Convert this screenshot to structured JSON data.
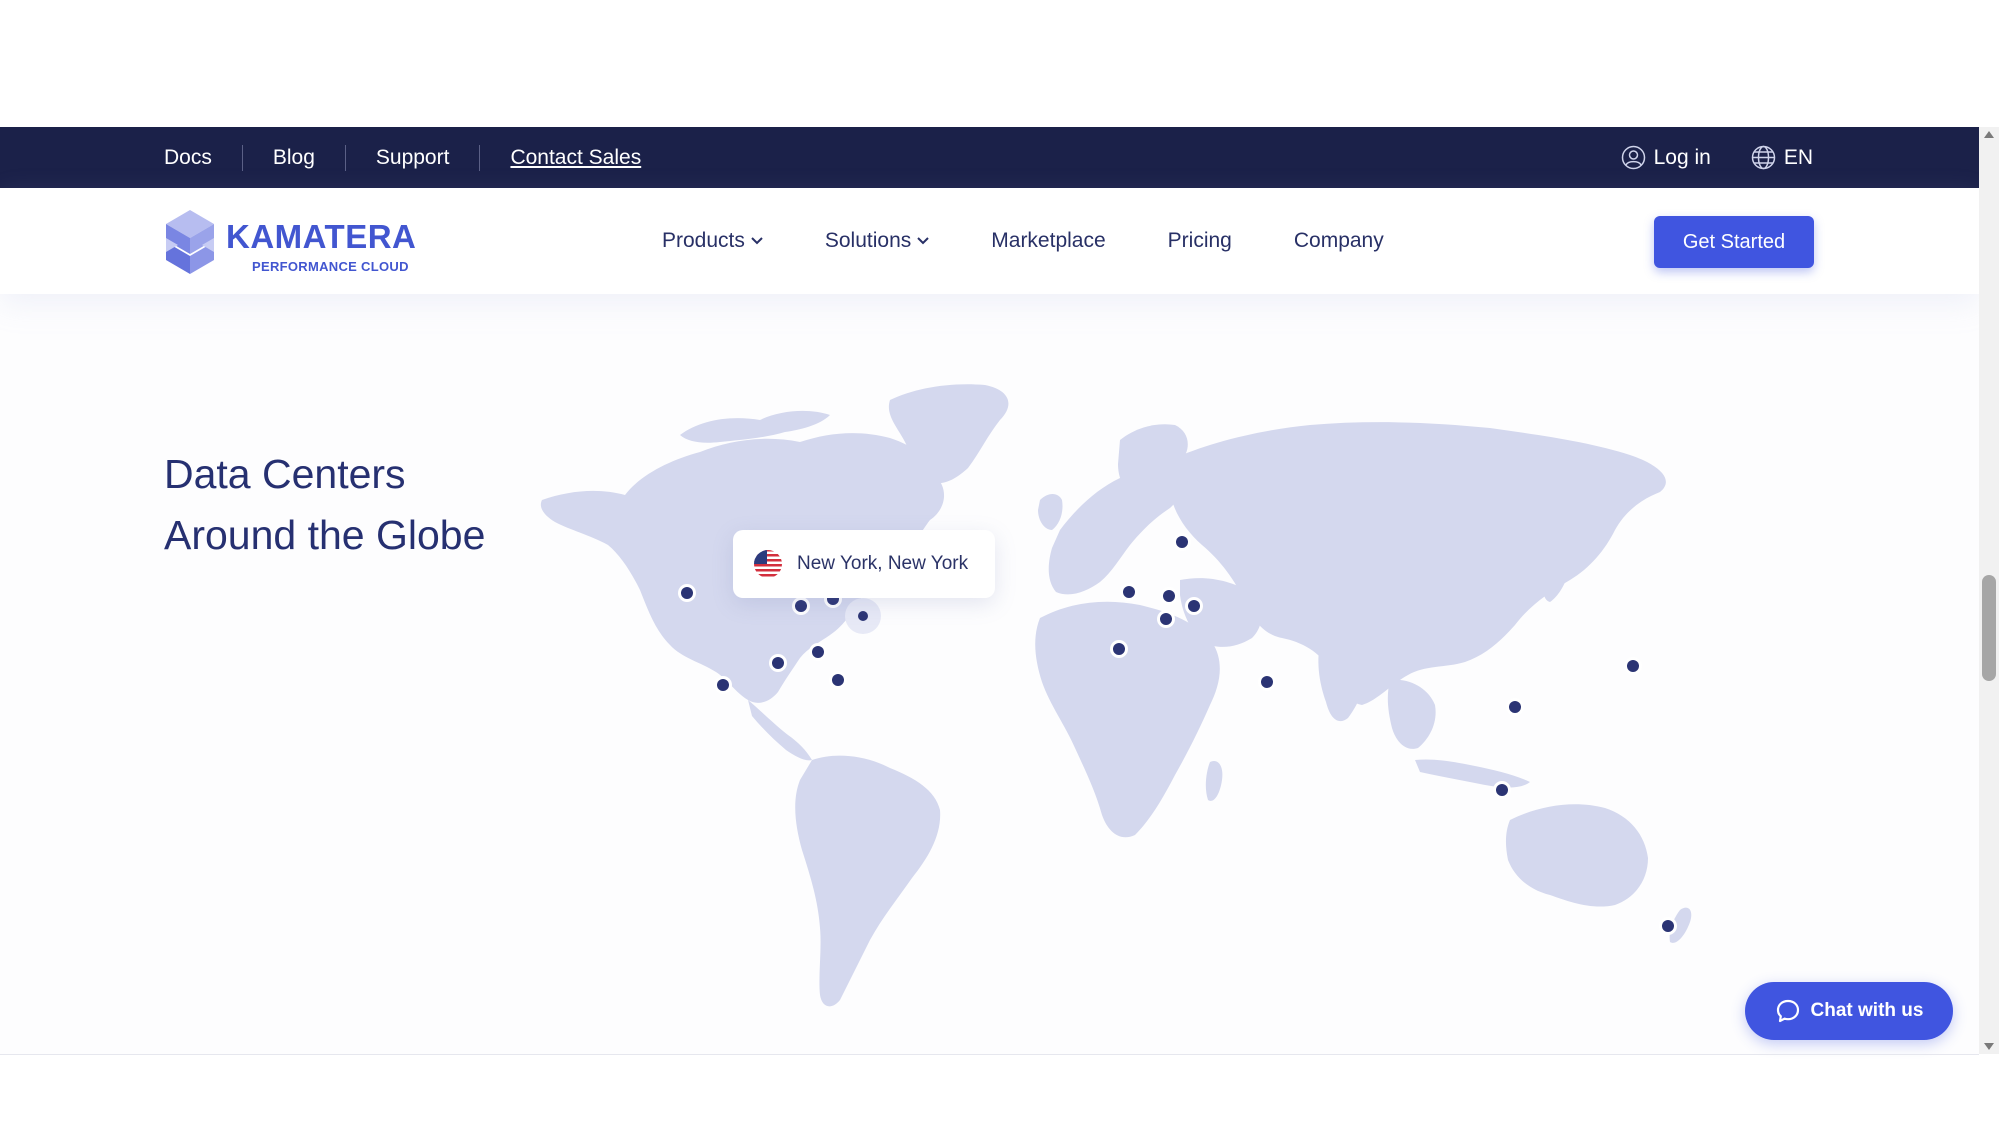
{
  "topbar": {
    "links": [
      {
        "label": "Docs"
      },
      {
        "label": "Blog"
      },
      {
        "label": "Support"
      },
      {
        "label": "Contact Sales"
      }
    ],
    "login_label": "Log in",
    "language_label": "EN"
  },
  "logo": {
    "wordmark": "KAMATERA",
    "tagline": "PERFORMANCE CLOUD"
  },
  "nav": {
    "items": [
      {
        "label": "Products",
        "has_dropdown": true
      },
      {
        "label": "Solutions",
        "has_dropdown": true
      },
      {
        "label": "Marketplace",
        "has_dropdown": false
      },
      {
        "label": "Pricing",
        "has_dropdown": false
      },
      {
        "label": "Company",
        "has_dropdown": false
      }
    ],
    "cta_label": "Get Started"
  },
  "hero": {
    "headline_line1": "Data Centers",
    "headline_line2": "Around the Globe",
    "tooltip_location": "New York, New York",
    "tooltip_flag": "us-flag-icon"
  },
  "chat": {
    "label": "Chat with us"
  },
  "colors": {
    "topbar_bg": "#1b2149",
    "brand_blue": "#4055e0",
    "headline": "#263071",
    "map_land": "#d4d8ee",
    "marker": "#2b3474"
  }
}
